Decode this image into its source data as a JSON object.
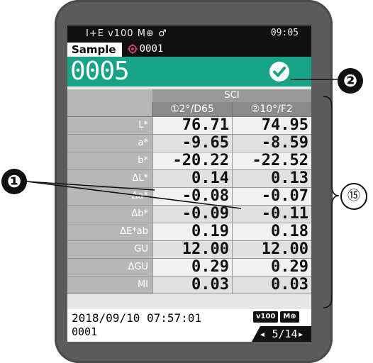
{
  "status_bar": {
    "left": "I+E ⅴ100 M⊕ ♂",
    "time": "09:05"
  },
  "sample_row": {
    "tab_label": "Sample",
    "id": "0001"
  },
  "header": {
    "sample_number": "0005",
    "result_icon": "check-circle-icon"
  },
  "table": {
    "group_label": "SCI",
    "columns": [
      "①2°/D65",
      "②10°/F2"
    ],
    "rows": [
      {
        "label": "L*",
        "v1": "76.71",
        "v2": "74.95"
      },
      {
        "label": "a*",
        "v1": "-9.65",
        "v2": "-8.59"
      },
      {
        "label": "b*",
        "v1": "-20.22",
        "v2": "-22.52"
      },
      {
        "label": "ΔL*",
        "v1": "0.14",
        "v2": "0.13"
      },
      {
        "label": "Δa*",
        "v1": "-0.08",
        "v2": "-0.07"
      },
      {
        "label": "Δb*",
        "v1": "-0.09",
        "v2": "-0.11"
      },
      {
        "label": "ΔE*ab",
        "v1": "0.19",
        "v2": "0.18"
      },
      {
        "label": "GU",
        "v1": "12.00",
        "v2": "12.00"
      },
      {
        "label": "ΔGU",
        "v1": "0.29",
        "v2": "0.29"
      },
      {
        "label": "MI",
        "v1": "0.03",
        "v2": "0.03"
      }
    ]
  },
  "footer": {
    "datetime": "2018/09/10 07:57:01",
    "id": "0001",
    "badges": [
      "ⅴ100",
      "M⊕"
    ],
    "pager": "◂ 5/14▸"
  },
  "callouts": {
    "one": "❶",
    "two": "❷",
    "fifteen": "⑮"
  },
  "colors": {
    "accent_green": "#16a487",
    "screen_bg": "#e7e7e7",
    "device_body": "#5b5b5b"
  }
}
